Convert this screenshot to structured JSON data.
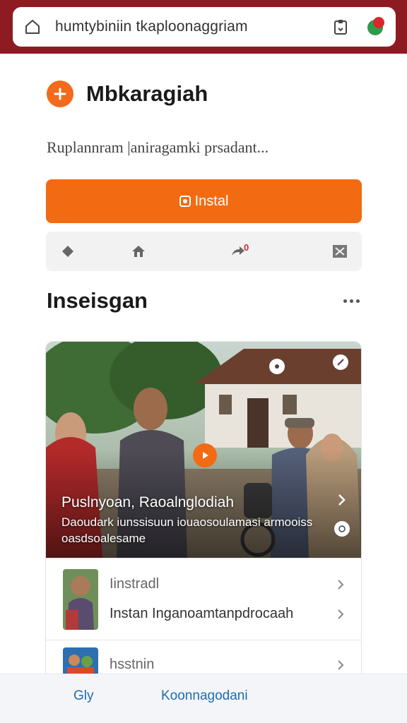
{
  "browser": {
    "url": "humtybiniin tkaploonaggriam",
    "icons": {
      "home": "home-icon",
      "clip": "clipboard-icon",
      "profile": "profile-dot-icon"
    },
    "bar_color": "#8e1b22"
  },
  "app": {
    "title": "Mbkaragiah",
    "subtitle": "Ruplannram |aniragamki prsadant...",
    "install_label": "Instal",
    "accent": "#f26b12",
    "actions": [
      {
        "icon": "diamond-icon"
      },
      {
        "icon": "house-icon"
      },
      {
        "icon": "share-icon",
        "badge": "0"
      },
      {
        "icon": "close-box-icon"
      }
    ]
  },
  "section": {
    "title": "Inseisgan",
    "featured": {
      "title": "Puslnyoan, Raoalnglodiah",
      "description": "Daoudark iunssisuun iouaosoulamasi armooiss oasdsoalesame"
    },
    "items": [
      {
        "line1": "Iinstradl",
        "line2": "Instan Inganoamtanpdrocaah"
      },
      {
        "line1": "hsstnin"
      }
    ]
  },
  "bottom_bar": {
    "left_label": "Gly",
    "center_label": "Koonnagodani"
  }
}
